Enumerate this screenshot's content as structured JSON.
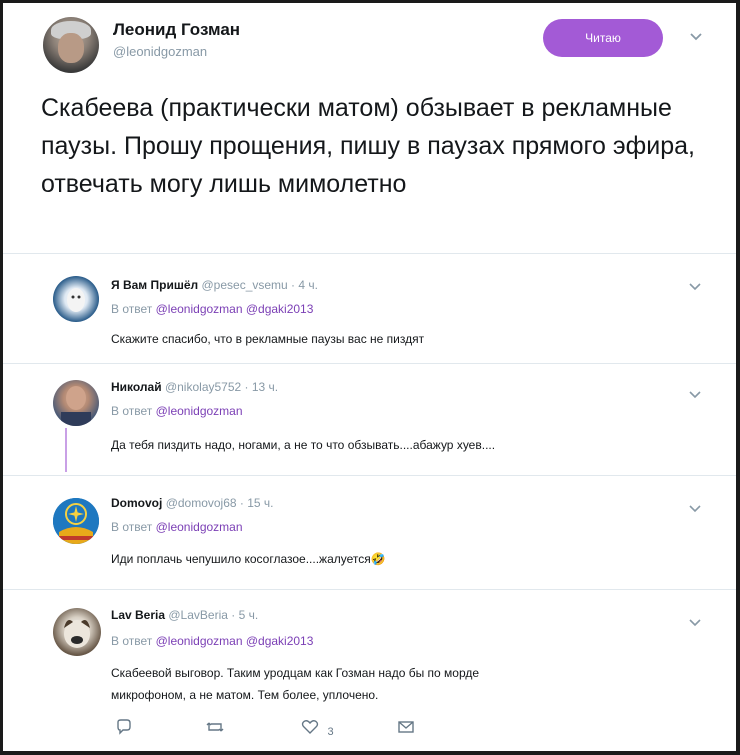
{
  "main_tweet": {
    "author_name": "Леонид Гозман",
    "author_handle": "@leonidgozman",
    "follow_label": "Читаю",
    "text": "Скабеева (практически матом) обзывает в рекламные паузы. Прошу прощения, пишу в паузах прямого эфира, отвечать могу лишь мимолетно"
  },
  "replies": [
    {
      "name": "Я Вам Пришёл",
      "meta": "@pesec_vsemu · 4 ч.",
      "reply_prefix": "В ответ",
      "reply_to": "@leonidgozman @dgaki2013",
      "text": "Скажите спасибо, что в рекламные паузы вас не пиздят"
    },
    {
      "name": "Николай",
      "meta": "@nikolay5752 · 13 ч.",
      "reply_prefix": "В ответ",
      "reply_to": "@leonidgozman",
      "text": "Да тебя пиздить надо, ногами, а не то что обзывать....абажур хуев...."
    },
    {
      "name": "Domovoj",
      "meta": "@domovoj68 · 15 ч.",
      "reply_prefix": "В ответ",
      "reply_to": "@leonidgozman",
      "text": "Иди поплачь чепушило косоглазое....жалуется🤣"
    },
    {
      "name": "Lav Beria",
      "meta": "@LavBeria · 5 ч.",
      "reply_prefix": "В ответ",
      "reply_to": "@leonidgozman @dgaki2013",
      "text_line1": "Скабеевой выговор. Таким уродцам как Гозман надо бы по морде",
      "text_line2": "микрофоном, а не матом. Тем более, уплочено."
    }
  ],
  "actions": {
    "reply_icon": "comment-icon",
    "retweet_icon": "retweet-icon",
    "like_icon": "heart-icon",
    "like_count": "3",
    "dm_icon": "mail-icon"
  },
  "colors": {
    "accent": "#a35ad6",
    "link": "#7b3fb5",
    "muted": "#8899a6"
  }
}
